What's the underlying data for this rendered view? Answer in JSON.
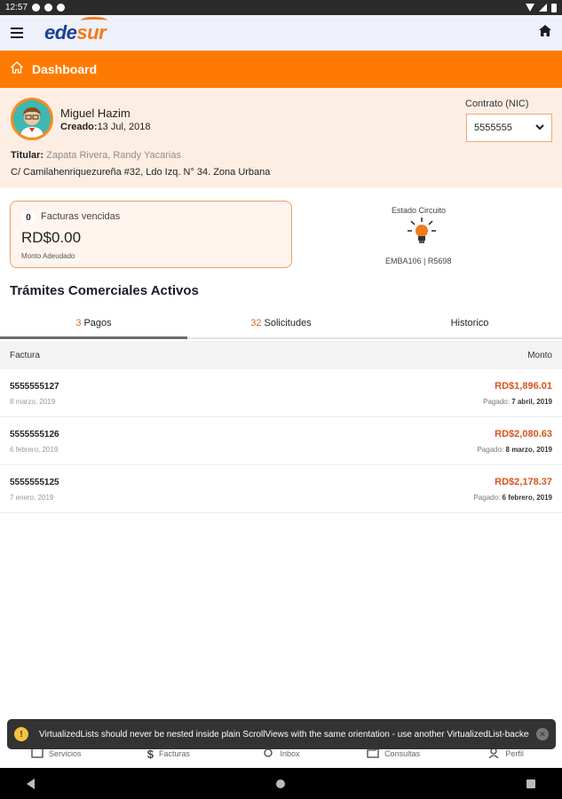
{
  "status_bar": {
    "time": "12:57"
  },
  "header": {
    "logo_main": "ede",
    "logo_accent": "sur"
  },
  "dashboard": {
    "title": "Dashboard"
  },
  "profile": {
    "name": "Miguel Hazim",
    "created_label": "Creado:",
    "created_value": "13 Jul, 2018",
    "titular_label": "Titular:",
    "titular_value": "Zapata Rivera, Randy Yacarias",
    "address": "C/ Camilahenriquezureña #32, Ldo Izq. N° 34. Zona Urbana"
  },
  "contract": {
    "label": "Contrato (NIC)",
    "value": "5555555"
  },
  "overdue": {
    "count": "0",
    "label": "Facturas vencidas",
    "amount": "RD$0.00",
    "sub": "Monto Adeudado"
  },
  "circuit": {
    "label": "Estado Circuito",
    "code": "EMBA106 | R5698"
  },
  "section": {
    "title": "Trámites Comerciales Activos"
  },
  "tabs": [
    {
      "num": "3",
      "label": "Pagos"
    },
    {
      "num": "32",
      "label": "Solicitudes"
    },
    {
      "num": "",
      "label": "Historico"
    }
  ],
  "table": {
    "col_left": "Factura",
    "col_right": "Monto"
  },
  "invoices": [
    {
      "id": "5555555127",
      "date": "8 marzo, 2019",
      "amount": "RD$1,896.01",
      "paid_label": "Pagado:",
      "paid_date": "7 abril, 2019"
    },
    {
      "id": "5555555126",
      "date": "6 febrero, 2019",
      "amount": "RD$2,080.63",
      "paid_label": "Pagado:",
      "paid_date": "8 marzo, 2019"
    },
    {
      "id": "5555555125",
      "date": "7 enero, 2019",
      "amount": "RD$2,178.37",
      "paid_label": "Pagado:",
      "paid_date": "6 febrero, 2019"
    }
  ],
  "bottom_nav": [
    {
      "label": "Servicios",
      "icon": "services-icon"
    },
    {
      "label": "Facturas",
      "icon": "dollar-icon"
    },
    {
      "label": "Inbox",
      "icon": "inbox-icon"
    },
    {
      "label": "Consultas",
      "icon": "consultas-icon"
    },
    {
      "label": "Perfil",
      "icon": "profile-icon"
    }
  ],
  "toast": {
    "icon": "!",
    "message": "VirtualizedLists should never be nested inside plain ScrollViews with the same orientation - use another VirtualizedList-backed ..."
  },
  "colors": {
    "accent": "#ff7a00",
    "brand_blue": "#1c3f94",
    "amount_red": "#d9531e"
  }
}
